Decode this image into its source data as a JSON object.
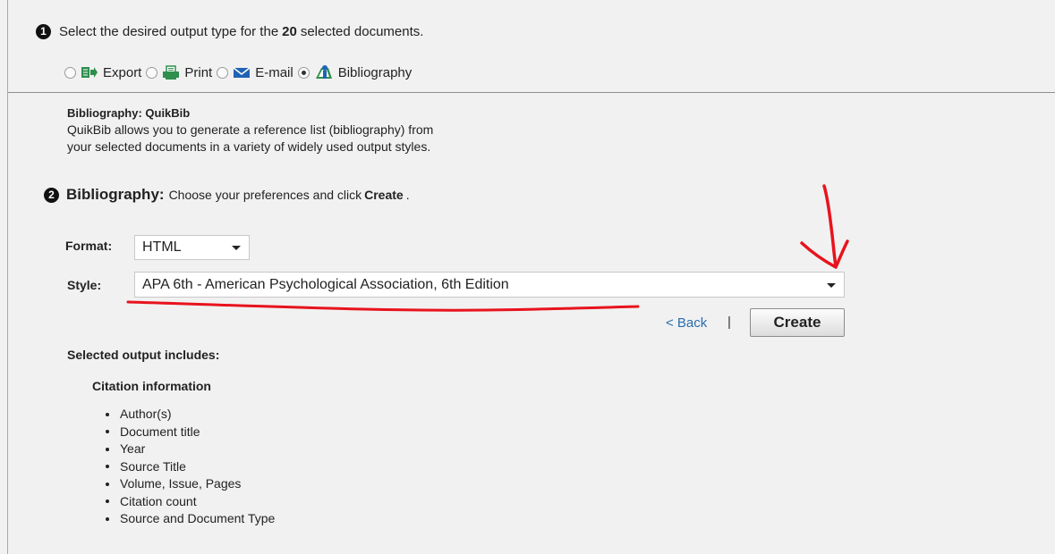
{
  "step1": {
    "number": "1",
    "text_before": "Select the desired output type for the",
    "count": "20",
    "text_after": "selected documents."
  },
  "output_types": [
    {
      "label": "Export",
      "icon": "export-icon",
      "selected": false
    },
    {
      "label": "Print",
      "icon": "printer-icon",
      "selected": false
    },
    {
      "label": "E-mail",
      "icon": "envelope-icon",
      "selected": false
    },
    {
      "label": "Bibliography",
      "icon": "bibliography-icon",
      "selected": true
    }
  ],
  "description": {
    "title": "Bibliography: QuikBib",
    "line1": "QuikBib allows you to generate a reference list (bibliography) from",
    "line2": "your selected documents in a variety of widely used output styles."
  },
  "step2": {
    "number": "2",
    "heading": "Bibliography:",
    "text": "Choose your preferences and click",
    "action": "Create",
    "period": "."
  },
  "form": {
    "format_label": "Format:",
    "format_value": "HTML",
    "style_label": "Style:",
    "style_value": "APA 6th - American Psychological Association, 6th Edition"
  },
  "actions": {
    "back_label": "< Back",
    "separator": "|",
    "create_label": "Create"
  },
  "output_section": {
    "heading": "Selected output includes:",
    "subheading": "Citation information",
    "items": [
      "Author(s)",
      "Document title",
      "Year",
      "Source Title",
      "Volume, Issue, Pages",
      "Citation count",
      "Source and Document Type"
    ]
  },
  "colors": {
    "background": "#f1f1f1",
    "link": "#2a6db0",
    "icon_green": "#2f8f4e",
    "icon_blue": "#1f63b5",
    "annotation_red": "#e8131d"
  }
}
